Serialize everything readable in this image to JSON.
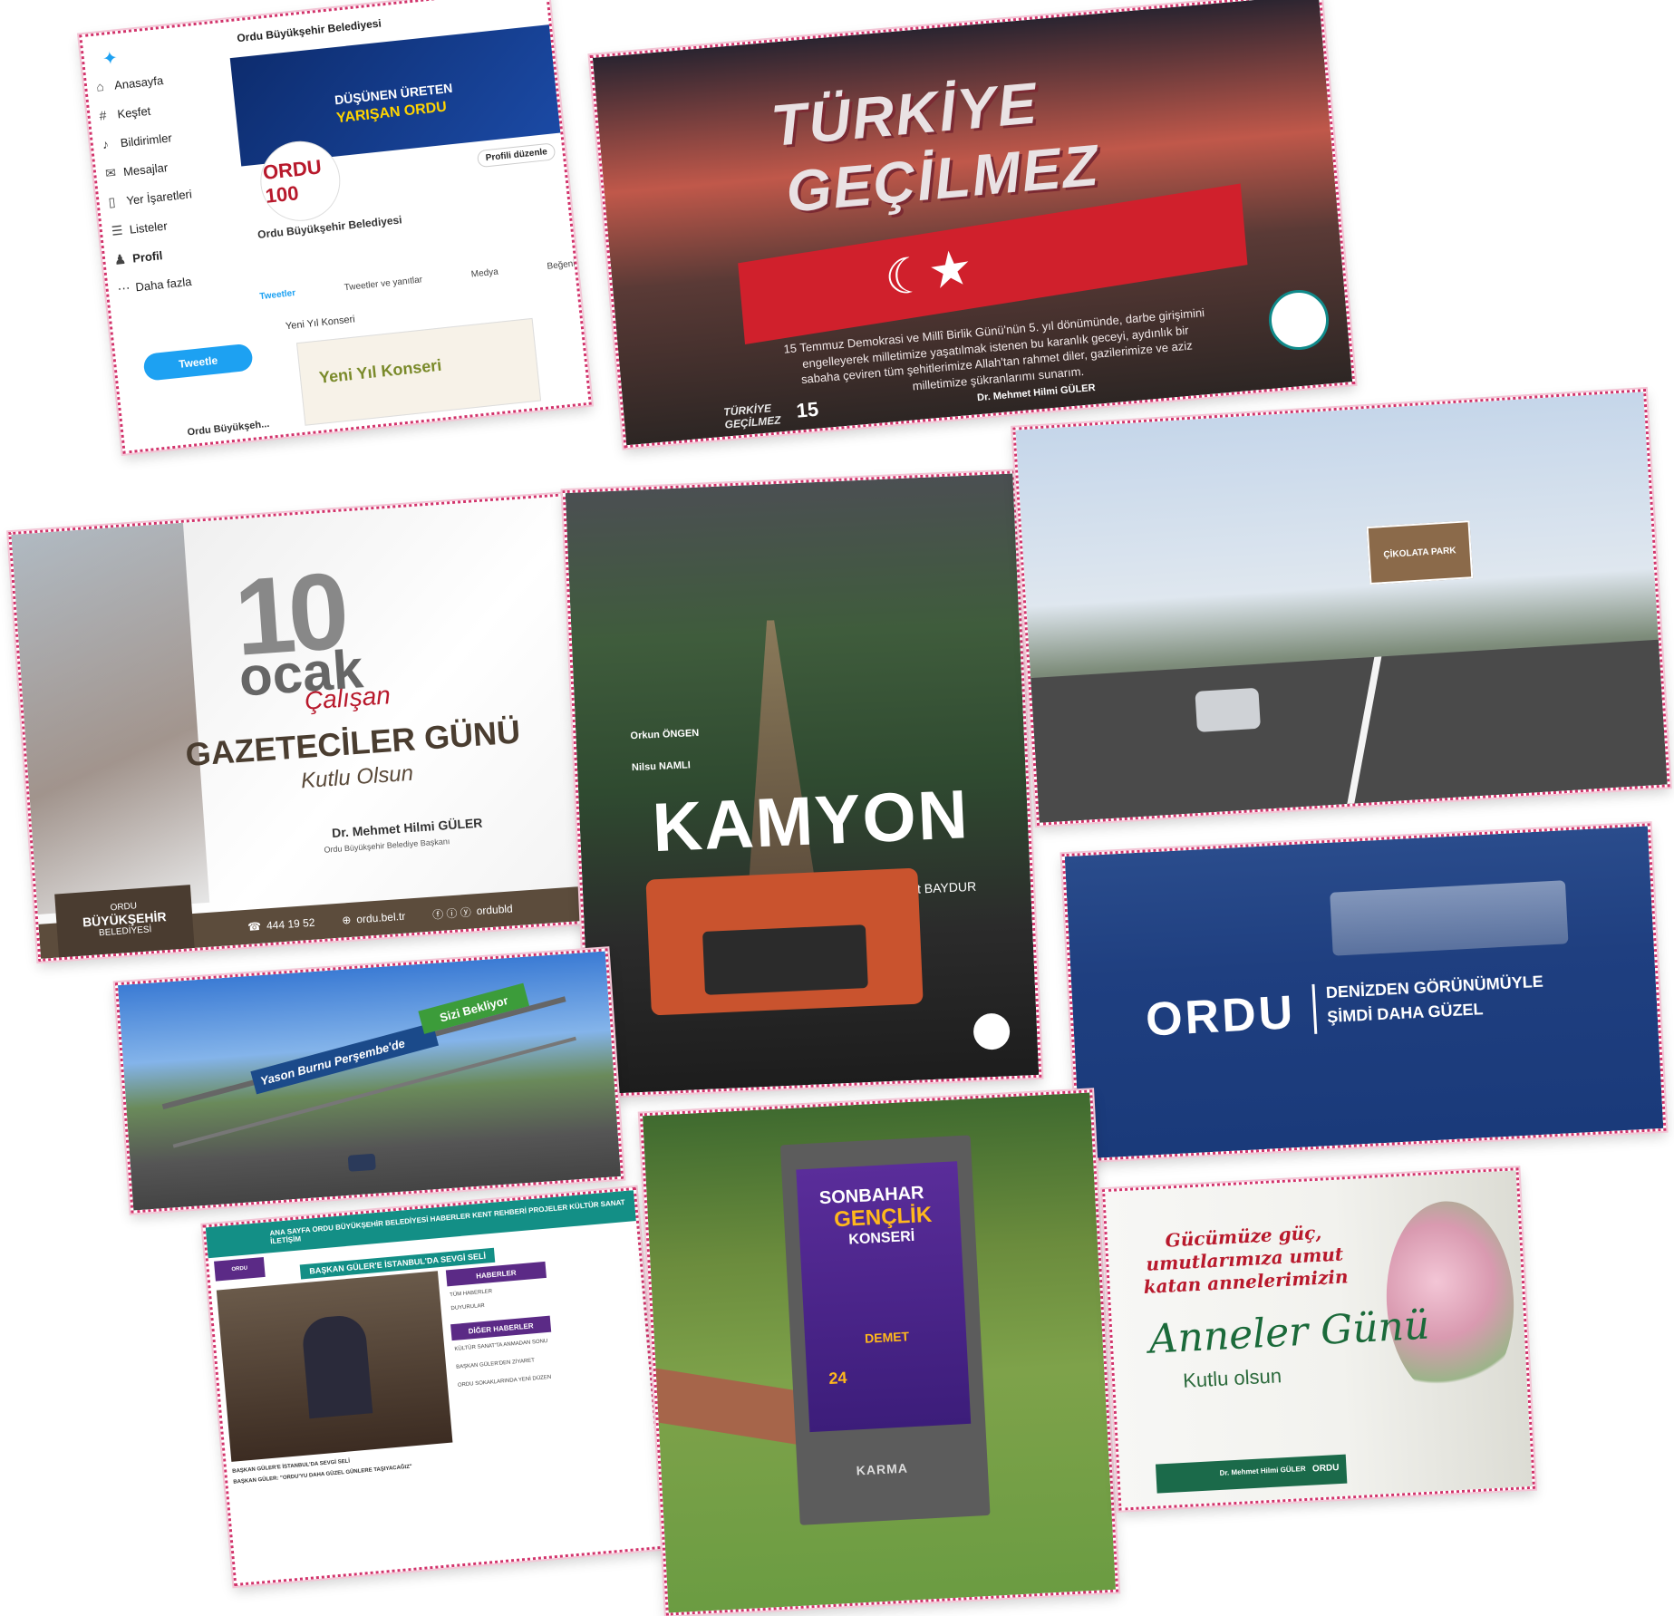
{
  "twitter": {
    "account_header": "Ordu Büyükşehir Belediyesi",
    "banner_line1": "DÜŞÜNEN ÜRETEN",
    "banner_line2": "YARIŞAN ORDU",
    "avatar_text": "ORDU 100",
    "edit_profile": "Profili düzenle",
    "profile_name": "Ordu Büyükşehir Belediyesi",
    "nav": [
      "Anasayfa",
      "Keşfet",
      "Bildirimler",
      "Mesajlar",
      "Yer İşaretleri",
      "Listeler",
      "Profil",
      "Daha fazla"
    ],
    "tweet_button": "Tweetle",
    "tabs": [
      "Tweetler",
      "Tweetler ve yanıtlar",
      "Medya",
      "Beğeni"
    ],
    "tweet_line1": "Yeni Yıl Konseri",
    "tweet_card": "Yeni Yıl Konseri",
    "footer_account": "Ordu Büyükşeh..."
  },
  "turkiye": {
    "title_line1": "TÜRKİYE",
    "title_line2": "GEÇİLMEZ",
    "message": "15 Temmuz Demokrasi ve Millî Birlik Günü'nün 5. yıl dönümünde, darbe girişimini engelleyerek milletimize yaşatılmak istenen bu karanlık geceyi, aydınlık bir sabaha çeviren tüm şehitlerimize Allah'tan rahmet diler, gazilerimize ve aziz milletimize şükranlarımı sunarım.",
    "signature": "Dr. Mehmet Hilmi GÜLER",
    "badge1": "TÜRKİYE GEÇİLMEZ",
    "badge2": "15"
  },
  "gazeteciler": {
    "number": "10",
    "month": "ocak",
    "calisan": "Çalışan",
    "main": "GAZETECİLER GÜNÜ",
    "kutlu": "Kutlu Olsun",
    "signature": "Dr. Mehmet Hilmi GÜLER",
    "role": "Ordu Büyükşehir Belediye Başkanı",
    "logo_line1": "ORDU",
    "logo_line2": "BÜYÜKŞEHİR",
    "logo_line3": "BELEDİYESİ",
    "phone": "444 19 52",
    "website": "ordu.bel.tr",
    "handle": "ordubld"
  },
  "kamyon": {
    "title": "KAMYON",
    "credits": [
      "Orkun ÖNGEN",
      "Nilsu NAMLI",
      "Memet BAYDUR"
    ]
  },
  "road": {
    "billboard": "ÇİKOLATA PARK"
  },
  "ordu_sea": {
    "big": "ORDU",
    "line1": "DENİZDEN GÖRÜNÜMÜYLE",
    "line2": "ŞİMDİ DAHA GÜZEL"
  },
  "bridge": {
    "banner1": "Yason Burnu Perşembe'de",
    "banner2": "Sizi Bekliyor"
  },
  "website": {
    "nav": "ANA SAYFA   ORDU BÜYÜKŞEHİR BELEDİYESİ   HABERLER   KENT REHBERİ   PROJELER   KÜLTÜR SANAT   İLETİŞİM",
    "headline": "BAŞKAN GÜLER'E İSTANBUL'DA SEVGİ SELİ",
    "side_heading1": "HABERLER",
    "side_heading2": "DİĞER HABERLER",
    "side_items": [
      "TÜM HABERLER",
      "DUYURULAR",
      "KÜLTÜR SANAT'TA ANMADAN SONU",
      "BAŞKAN GÜLER'DEN ZİYARET",
      "ORDU SOKAKLARINDA YENİ DÜZEN"
    ],
    "caption1": "BAŞKAN GÜLER'E İSTANBUL'DA SEVGİ SELİ",
    "caption2": "BAŞKAN GÜLER: \"ORDU'YU DAHA GÜZEL GÜNLERE TAŞIYACAĞIZ\""
  },
  "sonbahar": {
    "t1": "SONBAHAR",
    "t2": "GENÇLİK",
    "t3": "KONSERİ",
    "artist": "DEMET",
    "date": "24",
    "karma": "KARMA"
  },
  "anneler": {
    "line1": "Gücümüze güç,",
    "line2": "umutlarımıza umut",
    "line3": "katan annelerimizin",
    "big": "Anneler Günü",
    "kutlu": "Kutlu olsun",
    "footer_name": "Dr. Mehmet Hilmi GÜLER",
    "footer_brand": "ORDU"
  }
}
